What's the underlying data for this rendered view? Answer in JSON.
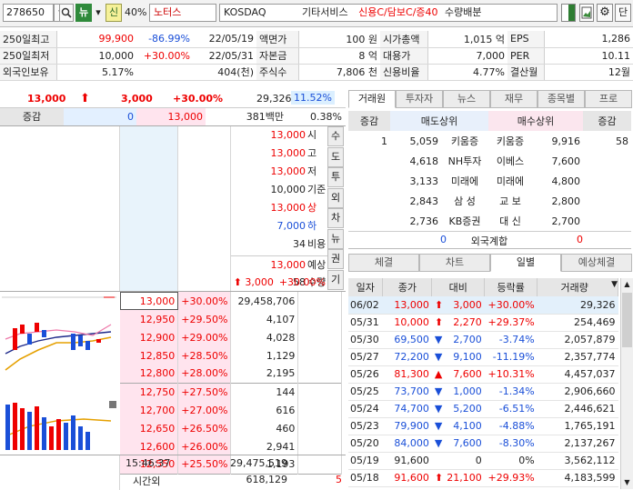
{
  "toolbar": {
    "code": "278650",
    "new_badge": "뉴",
    "credit_badge": "신",
    "margin_pct": "40%",
    "stock_name": "노터스",
    "market": "KOSDAQ",
    "sector": "기타서비스",
    "status": "신용C/담보C/증40",
    "extra": "수량배분",
    "help_btn": "단"
  },
  "info_rows": [
    [
      "250일최고",
      "99,900",
      "-86.99%",
      "22/05/19",
      "액면가",
      "100 원",
      "시가총액",
      "1,015 억",
      "EPS",
      "1,286"
    ],
    [
      "250일최저",
      "10,000",
      "+30.00%",
      "22/05/31",
      "자본금",
      "8 억",
      "대용가",
      "7,000",
      "PER",
      "10.11"
    ],
    [
      "외국인보유",
      "5.17%",
      "",
      "404(천)",
      "주식수",
      "7,806 천",
      "신용비율",
      "4.77%",
      "결산월",
      "12월"
    ]
  ],
  "price_bar": {
    "price": "13,000",
    "change": "3,000",
    "pct": "+30.00%",
    "volume": "29,326",
    "vol_ratio": "11.52%"
  },
  "change_row": {
    "label": "증감",
    "sell": "0",
    "price": "13,000",
    "amount": "381백만",
    "ratio": "0.38%"
  },
  "side_info": [
    {
      "v": "13,000",
      "l": "시"
    },
    {
      "v": "13,000",
      "l": "고"
    },
    {
      "v": "13,000",
      "l": "저"
    },
    {
      "v": "10,000",
      "l": "기준"
    },
    {
      "v": "13,000",
      "l": "상"
    },
    {
      "v": "7,000",
      "l": "하"
    },
    {
      "v": "34",
      "l": "비용"
    },
    {
      "v": "13,000",
      "l": "예상"
    },
    {
      "v": "58",
      "l": "수량"
    }
  ],
  "side_expected": {
    "change": "3,000",
    "pct": "+30.00%"
  },
  "side_tabs": [
    "수",
    "도",
    "투",
    "외",
    "차",
    "뉴",
    "권",
    "기"
  ],
  "bid_rows": [
    {
      "p": "13,000",
      "pct": "+30.00%",
      "q": "29,458,706"
    },
    {
      "p": "12,950",
      "pct": "+29.50%",
      "q": "4,107"
    },
    {
      "p": "12,900",
      "pct": "+29.00%",
      "q": "4,028"
    },
    {
      "p": "12,850",
      "pct": "+28.50%",
      "q": "1,129"
    },
    {
      "p": "12,800",
      "pct": "+28.00%",
      "q": "2,195"
    },
    {
      "p": "12,750",
      "pct": "+27.50%",
      "q": "144"
    },
    {
      "p": "12,700",
      "pct": "+27.00%",
      "q": "616"
    },
    {
      "p": "12,650",
      "pct": "+26.50%",
      "q": "460"
    },
    {
      "p": "12,600",
      "pct": "+26.00%",
      "q": "2,941"
    },
    {
      "p": "12,550",
      "pct": "+25.50%",
      "q": "1,193"
    }
  ],
  "footer": {
    "time": "15:46:37",
    "total": "29,475,519",
    "after_label": "시간외",
    "after_vol": "618,129",
    "after_cnt": "5"
  },
  "right_tabs": [
    "거래원",
    "투자자",
    "뉴스",
    "재무",
    "종목별",
    "프로"
  ],
  "broker_hdr": {
    "chg": "증감",
    "sell": "매도상위",
    "buy": "매수상위",
    "chg2": "증감"
  },
  "brokers": [
    {
      "chg": "1",
      "sq": "5,059",
      "sn": "키움증",
      "bn": "키움증",
      "bq": "9,916",
      "chg2": "58"
    },
    {
      "chg": "",
      "sq": "4,618",
      "sn": "NH투자",
      "bn": "이베스",
      "bq": "7,600",
      "chg2": ""
    },
    {
      "chg": "",
      "sq": "3,133",
      "sn": "미래에",
      "bn": "미래에",
      "bq": "4,800",
      "chg2": ""
    },
    {
      "chg": "",
      "sq": "2,843",
      "sn": "삼 성",
      "bn": "교 보",
      "bq": "2,800",
      "chg2": ""
    },
    {
      "chg": "",
      "sq": "2,736",
      "sn": "KB증권",
      "bn": "대 신",
      "bq": "2,700",
      "chg2": ""
    }
  ],
  "foreign_sum": {
    "sell": "0",
    "label": "외국계합",
    "buy": "0"
  },
  "sub_tabs": [
    "체결",
    "차트",
    "일별",
    "예상체결"
  ],
  "daily_hdr": [
    "일자",
    "종가",
    "대비",
    "등락률",
    "거래량"
  ],
  "daily": [
    {
      "d": "06/02",
      "c": "13,000",
      "a": "up",
      "v": "3,000",
      "p": "+30.00%",
      "vol": "29,326",
      "col": "red"
    },
    {
      "d": "05/31",
      "c": "10,000",
      "a": "up",
      "v": "2,270",
      "p": "+29.37%",
      "vol": "254,469",
      "col": "red"
    },
    {
      "d": "05/30",
      "c": "69,500",
      "a": "dn",
      "v": "2,700",
      "p": "-3.74%",
      "vol": "2,057,879",
      "col": "blue"
    },
    {
      "d": "05/27",
      "c": "72,200",
      "a": "dn",
      "v": "9,100",
      "p": "-11.19%",
      "vol": "2,357,774",
      "col": "blue"
    },
    {
      "d": "05/26",
      "c": "81,300",
      "a": "tri",
      "v": "7,600",
      "p": "+10.31%",
      "vol": "4,457,037",
      "col": "red"
    },
    {
      "d": "05/25",
      "c": "73,700",
      "a": "dn",
      "v": "1,000",
      "p": "-1.34%",
      "vol": "2,906,660",
      "col": "blue"
    },
    {
      "d": "05/24",
      "c": "74,700",
      "a": "dn",
      "v": "5,200",
      "p": "-6.51%",
      "vol": "2,446,621",
      "col": "blue"
    },
    {
      "d": "05/23",
      "c": "79,900",
      "a": "dn",
      "v": "4,100",
      "p": "-4.88%",
      "vol": "1,765,191",
      "col": "blue"
    },
    {
      "d": "05/20",
      "c": "84,000",
      "a": "dn",
      "v": "7,600",
      "p": "-8.30%",
      "vol": "2,137,267",
      "col": "blue"
    },
    {
      "d": "05/19",
      "c": "91,600",
      "a": "",
      "v": "0",
      "p": "0%",
      "vol": "3,562,112",
      "col": "black"
    },
    {
      "d": "05/18",
      "c": "91,600",
      "a": "up",
      "v": "21,100",
      "p": "+29.93%",
      "vol": "4,183,599",
      "col": "red"
    }
  ],
  "colors": {
    "up": "#e00000",
    "down": "#1a4fd8",
    "highlight": "#ffe4ee",
    "header": "#e6e6e6"
  }
}
